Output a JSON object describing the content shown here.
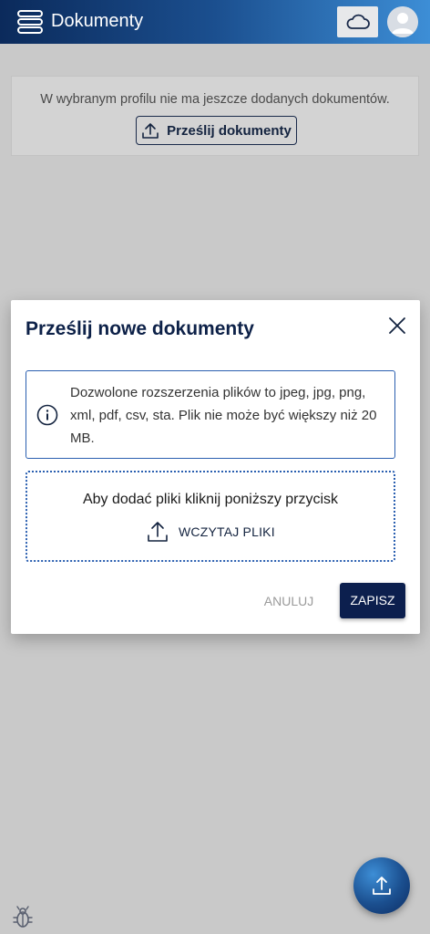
{
  "header": {
    "title": "Dokumenty",
    "menu_icon": "menu-stack-icon",
    "cloud_icon": "cloud-icon",
    "avatar_icon": "user-avatar-icon"
  },
  "empty_state": {
    "message": "W wybranym profilu nie ma jeszcze dodanych dokumentów.",
    "upload_button": "Prześlij dokumenty"
  },
  "modal": {
    "title": "Prześlij nowe dokumenty",
    "info": "Dozwolone rozszerzenia plików to jpeg, jpg, png, xml, pdf, csv, sta. Plik nie może być większy niż 20 MB.",
    "drop_zone_text": "Aby dodać pliki kliknij poniższy przycisk",
    "load_files_button": "WCZYTAJ PLIKI",
    "cancel_button": "ANULUJ",
    "save_button": "ZAPISZ"
  },
  "colors": {
    "header_dark": "#0b2a5b",
    "header_light": "#3d8ed6",
    "primary": "#0c1f4e",
    "info_border": "#2a5fb0",
    "overlay": "#c9c9c9"
  }
}
